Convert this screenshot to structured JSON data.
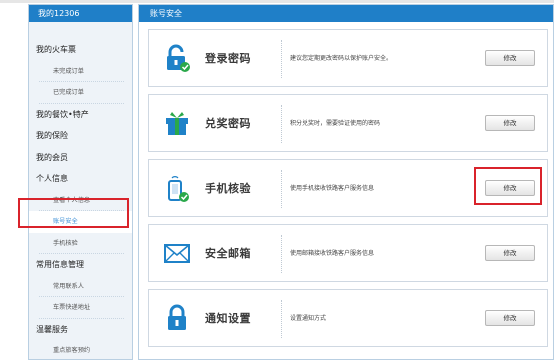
{
  "sidebar": {
    "header": "我的12306",
    "items": [
      {
        "label": "我的火车票",
        "type": "cat"
      },
      {
        "label": "未完成订单",
        "type": "sub"
      },
      {
        "label": "已完成订单",
        "type": "sub"
      },
      {
        "label": "我的餐饮•特产",
        "type": "cat"
      },
      {
        "label": "我的保险",
        "type": "cat"
      },
      {
        "label": "我的会员",
        "type": "cat"
      },
      {
        "label": "个人信息",
        "type": "cat"
      },
      {
        "label": "查看个人信息",
        "type": "sub"
      },
      {
        "label": "账号安全",
        "type": "sub",
        "active": true
      },
      {
        "label": "手机核验",
        "type": "sub"
      },
      {
        "label": "常用信息管理",
        "type": "cat"
      },
      {
        "label": "常用联系人",
        "type": "sub"
      },
      {
        "label": "车票快递地址",
        "type": "sub"
      },
      {
        "label": "温馨服务",
        "type": "cat"
      },
      {
        "label": "重点旅客预约",
        "type": "sub"
      }
    ]
  },
  "main": {
    "header": "账号安全",
    "rows": [
      {
        "icon": "lock-icon",
        "title": "登录密码",
        "desc": "建议您定期更改密码以保护账户安全。",
        "button": "修改"
      },
      {
        "icon": "gift-icon",
        "title": "兑奖密码",
        "desc": "积分兑奖时，需要验证使用的密码",
        "button": "修改"
      },
      {
        "icon": "phone-icon",
        "title": "手机核验",
        "desc": "使用手机接收铁路客户服务信息",
        "button": "修改"
      },
      {
        "icon": "mail-icon",
        "title": "安全邮箱",
        "desc": "使用邮箱接收铁路客户服务信息",
        "button": "修改"
      },
      {
        "icon": "lock-icon",
        "title": "通知设置",
        "desc": "设置通知方式",
        "button": "修改"
      }
    ]
  },
  "colors": {
    "header_blue": "#1f7fc8",
    "icon_green": "#2aa84a",
    "icon_blue": "#1f82c8",
    "highlight_red": "#d9232b",
    "active_link": "#3b8fd6"
  }
}
